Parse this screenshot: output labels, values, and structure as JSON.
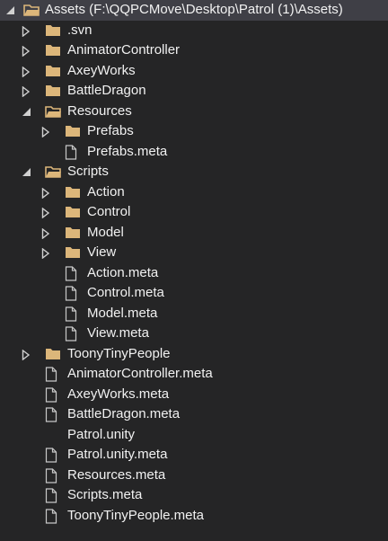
{
  "root": {
    "label": "Assets (F:\\QQPCMove\\Desktop\\Patrol (1)\\Assets)"
  },
  "items": [
    {
      "label": ".svn",
      "type": "folder",
      "expanded": false,
      "depth": 1
    },
    {
      "label": "AnimatorController",
      "type": "folder",
      "expanded": false,
      "depth": 1
    },
    {
      "label": "AxeyWorks",
      "type": "folder",
      "expanded": false,
      "depth": 1
    },
    {
      "label": "BattleDragon",
      "type": "folder",
      "expanded": false,
      "depth": 1
    },
    {
      "label": "Resources",
      "type": "folder",
      "expanded": true,
      "depth": 1
    },
    {
      "label": "Prefabs",
      "type": "folder",
      "expanded": false,
      "depth": 2
    },
    {
      "label": "Prefabs.meta",
      "type": "file",
      "depth": 2
    },
    {
      "label": "Scripts",
      "type": "folder",
      "expanded": true,
      "depth": 1
    },
    {
      "label": "Action",
      "type": "folder",
      "expanded": false,
      "depth": 2
    },
    {
      "label": "Control",
      "type": "folder",
      "expanded": false,
      "depth": 2
    },
    {
      "label": "Model",
      "type": "folder",
      "expanded": false,
      "depth": 2
    },
    {
      "label": "View",
      "type": "folder",
      "expanded": false,
      "depth": 2
    },
    {
      "label": "Action.meta",
      "type": "file",
      "depth": 2
    },
    {
      "label": "Control.meta",
      "type": "file",
      "depth": 2
    },
    {
      "label": "Model.meta",
      "type": "file",
      "depth": 2
    },
    {
      "label": "View.meta",
      "type": "file",
      "depth": 2
    },
    {
      "label": "ToonyTinyPeople",
      "type": "folder",
      "expanded": false,
      "depth": 1
    },
    {
      "label": "AnimatorController.meta",
      "type": "file",
      "depth": 1
    },
    {
      "label": "AxeyWorks.meta",
      "type": "file",
      "depth": 1
    },
    {
      "label": "BattleDragon.meta",
      "type": "file",
      "depth": 1
    },
    {
      "label": "Patrol.unity",
      "type": "unity",
      "depth": 1
    },
    {
      "label": "Patrol.unity.meta",
      "type": "file",
      "depth": 1
    },
    {
      "label": "Resources.meta",
      "type": "file",
      "depth": 1
    },
    {
      "label": "Scripts.meta",
      "type": "file",
      "depth": 1
    },
    {
      "label": "ToonyTinyPeople.meta",
      "type": "file",
      "depth": 1
    }
  ],
  "colors": {
    "background": "#252526",
    "selected_row": "#3f3f46",
    "folder": "#dcb67a",
    "text": "#f1f1f1",
    "arrow": "#d0d0d0"
  }
}
